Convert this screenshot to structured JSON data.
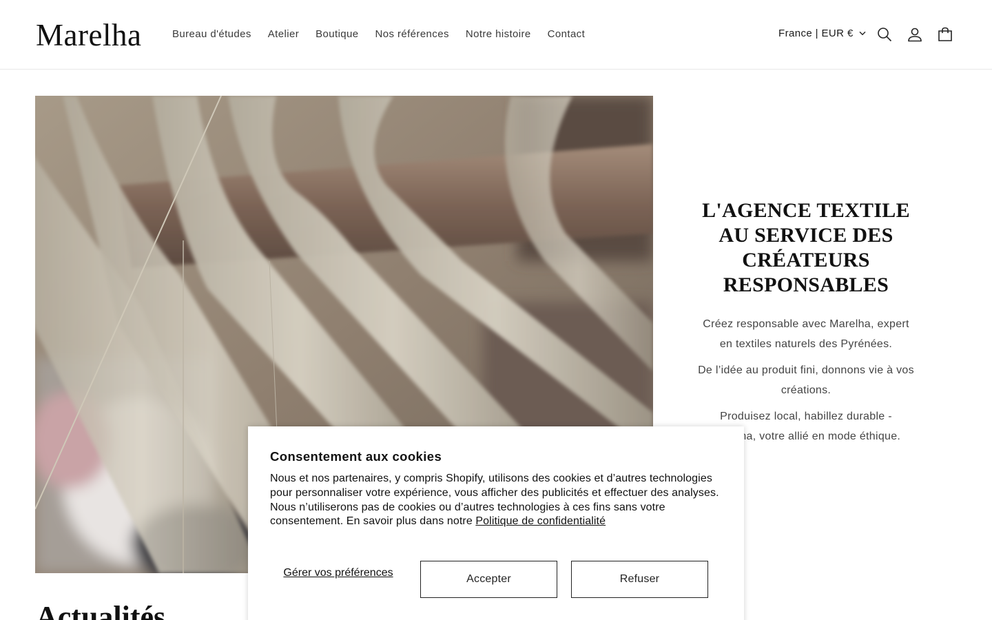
{
  "header": {
    "logo": "Marelha",
    "nav": [
      {
        "label": "Bureau d'études"
      },
      {
        "label": "Atelier"
      },
      {
        "label": "Boutique"
      },
      {
        "label": "Nos références"
      },
      {
        "label": "Notre histoire"
      },
      {
        "label": "Contact"
      }
    ],
    "locale": "France | EUR €",
    "icons": [
      "chevron-down-icon",
      "search-icon",
      "account-icon",
      "cart-icon"
    ]
  },
  "hero": {
    "image": "loom-warp-threads",
    "title": "L'AGENCE TEXTILE AU SERVICE DES CRÉATEURS RESPONSABLES",
    "paragraphs": [
      "Créez responsable avec Marelha, expert en textiles naturels des Pyrénées.",
      "De l’idée au produit fini, donnons vie à vos créations.",
      "Produisez local, habillez durable - Marelha, votre allié en mode éthique."
    ]
  },
  "news": {
    "title": "Actualités"
  },
  "cookie": {
    "title": "Consentement aux cookies",
    "body": "Nous et nos partenaires, y compris Shopify, utilisons des cookies et d’autres technologies pour personnaliser votre expérience, vous afficher des publicités et effectuer des analyses. Nous n’utiliserons pas de cookies ou d’autres technologies à ces fins sans votre consentement. En savoir plus dans notre ",
    "policy_link": "Politique de confidentialité",
    "manage_label": "Gérer vos préférences",
    "accept_label": "Accepter",
    "refuse_label": "Refuser"
  },
  "colors": {
    "text": "#121212",
    "muted": "#444444",
    "border": "#e8e8e8"
  }
}
